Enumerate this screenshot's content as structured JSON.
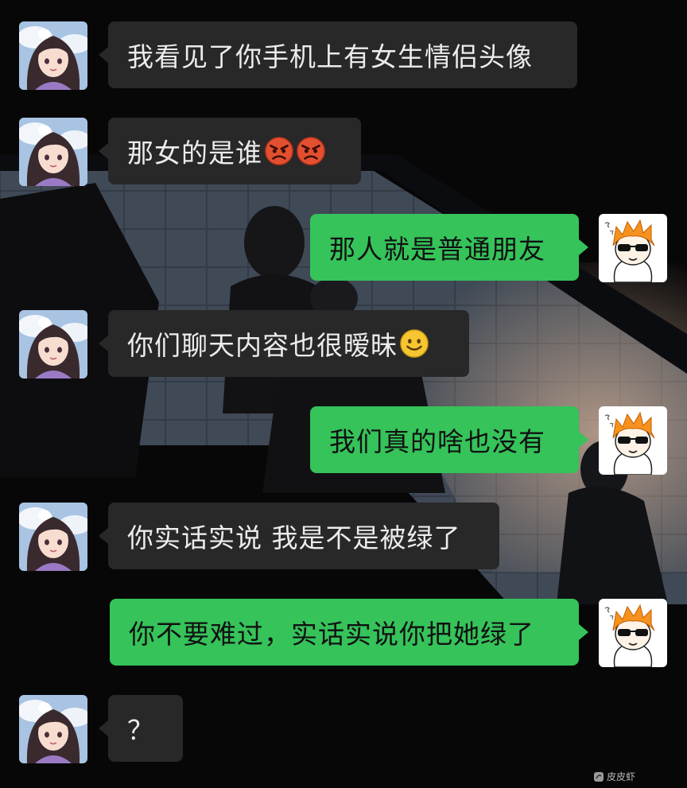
{
  "chat": {
    "messages": [
      {
        "side": "in",
        "text": "我看见了你手机上有女生情侣头像",
        "avatar": "girl-avatar"
      },
      {
        "side": "in",
        "text": "那女的是谁",
        "emoji": [
          "angry-face-icon",
          "angry-face-icon"
        ],
        "avatar": "girl-avatar"
      },
      {
        "side": "out",
        "text": "那人就是普通朋友",
        "avatar": "boy-avatar"
      },
      {
        "side": "in",
        "text": "你们聊天内容也很暧昧",
        "emoji": [
          "smile-face-icon"
        ],
        "avatar": "girl-avatar"
      },
      {
        "side": "out",
        "text": "我们真的啥也没有",
        "avatar": "boy-avatar"
      },
      {
        "side": "in",
        "text": "你实话实说 我是不是被绿了",
        "avatar": "girl-avatar"
      },
      {
        "side": "out",
        "text": "你不要难过，实话实说你把她绿了",
        "avatar": "boy-avatar"
      },
      {
        "side": "in",
        "text": "？",
        "avatar": "girl-avatar"
      }
    ]
  },
  "watermark": {
    "text": "皮皮虾",
    "icon": "shrimp-logo-icon"
  },
  "colors": {
    "incoming_bubble": "#282829",
    "outgoing_bubble": "#35c35a",
    "background": "#070708"
  }
}
